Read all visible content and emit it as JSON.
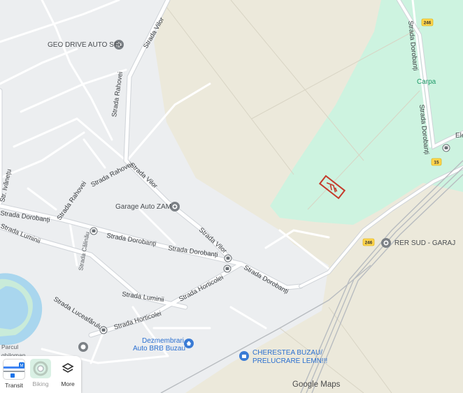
{
  "map": {
    "brand": "Google Maps",
    "colors": {
      "land": "#eceef0",
      "field": "#ece9db",
      "park": "#cdf3e0",
      "water": "#a9d6ee",
      "road": "#ffffff",
      "road_outline": "#cfd3d8",
      "rail": "#b8bcc0",
      "marker": "#c43a2a"
    }
  },
  "pois": {
    "geo_drive": "GEO DRIVE AUTO SRL",
    "garage_zam": "Garage Auto ZAM",
    "rer_sud": "RER SUD - GARAJ",
    "dezmembrari_1": "Dezmembrari",
    "dezmembrari_2": "Auto BRB Buzau",
    "cherestea_1": "CHERESTEA BUZAU/",
    "cherestea_2": "PRELUCRARE LEMN!!!",
    "carpa": "Carpa",
    "ele": "Ele",
    "parcul_1": "Parcul",
    "parcul_2": "ghiloman"
  },
  "streets": {
    "vilor_top": "Strada Vilor",
    "rahovei_1": "Strada Rahovei",
    "rahovei_2": "Strada Rahovei",
    "rahovei_3": "Strada Rahovei",
    "vilor_mid": "Strada Vilor",
    "vilor_low": "Strada Vilor",
    "ivanetu": "Str. Ivănețu",
    "dorobanti_1": "Strada Dorobanți",
    "dorobanti_2": "Strada Dorobanți",
    "dorobanti_3": "Strada Dorobanți",
    "dorobanti_4": "Strada Dorobanți",
    "dorobanti_ne": "Strada Dorobanți",
    "dorobanti_e": "Strada Dorobanți",
    "luminii_1": "Strada Luminii",
    "luminii_2": "Strada Luminii",
    "calinau": "Strada Călinău",
    "horticolei_1": "Strada Horticolei",
    "horticolei_2": "Strada Horticolei",
    "luceafarului": "Strada Luceafărului"
  },
  "route_badges": {
    "r246_top": "246",
    "r246_mid": "246",
    "r15": "15"
  },
  "layers": {
    "transit": "Transit",
    "biking": "Biking",
    "more": "More"
  }
}
